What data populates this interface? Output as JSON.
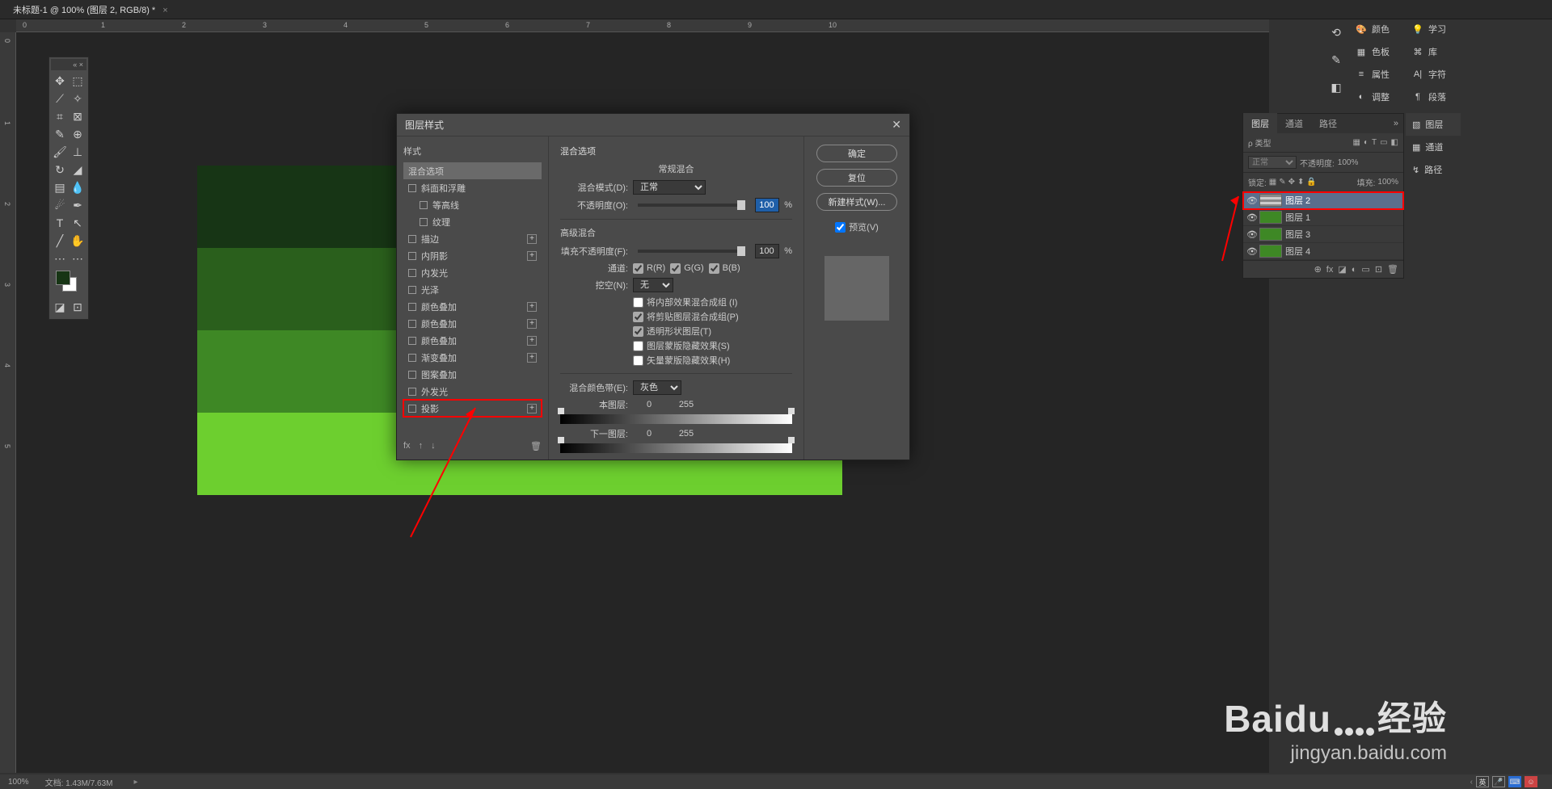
{
  "doc_tab": {
    "title": "未标题-1 @ 100% (图层 2, RGB/8) *"
  },
  "ruler_top": [
    "0",
    "1",
    "2",
    "3",
    "4",
    "5",
    "6",
    "7",
    "8",
    "9",
    "10"
  ],
  "ruler_left": [
    "0",
    "1",
    "2",
    "3",
    "4",
    "5"
  ],
  "status": {
    "zoom": "100%",
    "doc_info": "文档: 1.43M/7.63M"
  },
  "right_panels_col1": [
    {
      "icon": "🎨",
      "label": "颜色"
    },
    {
      "icon": "▦",
      "label": "色板"
    },
    {
      "icon": "≡",
      "label": "属性"
    },
    {
      "icon": "◐",
      "label": "调整"
    }
  ],
  "right_panels_col2": [
    {
      "icon": "💡",
      "label": "学习"
    },
    {
      "icon": "⌘",
      "label": "库"
    },
    {
      "icon": "A|",
      "label": "字符"
    },
    {
      "icon": "¶",
      "label": "段落"
    }
  ],
  "layers_panel": {
    "tabs": [
      "图层",
      "通道",
      "路径"
    ],
    "menu_icon": "»",
    "kind_label": "ρ 类型",
    "filter_icons": [
      "▦",
      "◐",
      "T",
      "▭",
      "◧"
    ],
    "blend_mode": "正常",
    "opacity_label": "不透明度:",
    "opacity_value": "100%",
    "lock_label": "锁定:",
    "lock_icons": [
      "▦",
      "✎",
      "✥",
      "⬍",
      "🔒"
    ],
    "fill_label": "填充:",
    "fill_value": "100%",
    "layers": [
      {
        "name": "图层 2",
        "selected": true,
        "highlight": true
      },
      {
        "name": "图层 1"
      },
      {
        "name": "图层 3"
      },
      {
        "name": "图层 4"
      }
    ],
    "footer_icons": [
      "⊕",
      "fx",
      "◪",
      "◐",
      "▭",
      "⊡",
      "🗑"
    ]
  },
  "stack_tabs": [
    {
      "icon": "▧",
      "label": "图层",
      "active": true
    },
    {
      "icon": "▦",
      "label": "通道"
    },
    {
      "icon": "↯",
      "label": "路径"
    }
  ],
  "dialog": {
    "title": "图层样式",
    "left_title": "样式",
    "styles": [
      {
        "label": "混合选项",
        "selected": true,
        "no_check": true
      },
      {
        "label": "斜面和浮雕"
      },
      {
        "label": "等高线",
        "indent": true
      },
      {
        "label": "纹理",
        "indent": true
      },
      {
        "label": "描边",
        "plus": true
      },
      {
        "label": "内阴影",
        "plus": true
      },
      {
        "label": "内发光"
      },
      {
        "label": "光泽"
      },
      {
        "label": "颜色叠加",
        "plus": true
      },
      {
        "label": "颜色叠加",
        "plus": true
      },
      {
        "label": "颜色叠加",
        "plus": true
      },
      {
        "label": "渐变叠加",
        "plus": true
      },
      {
        "label": "图案叠加"
      },
      {
        "label": "外发光"
      },
      {
        "label": "投影",
        "plus": true,
        "highlight": true
      }
    ],
    "left_footer_icons": [
      "fx",
      "↑",
      "↓"
    ],
    "trash_icon": "🗑",
    "mid": {
      "title": "混合选项",
      "general_title": "常规混合",
      "blend_mode_label": "混合模式(D):",
      "blend_mode_value": "正常",
      "opacity_label": "不透明度(O):",
      "opacity_value": "100",
      "percent": "%",
      "advanced_title": "高级混合",
      "fill_opacity_label": "填充不透明度(F):",
      "fill_opacity_value": "100",
      "channels_label": "通道:",
      "channels": [
        {
          "l": "R(R)",
          "c": true
        },
        {
          "l": "G(G)",
          "c": true
        },
        {
          "l": "B(B)",
          "c": true
        }
      ],
      "knockout_label": "挖空(N):",
      "knockout_value": "无",
      "checks": [
        {
          "l": "将内部效果混合成组 (I)",
          "c": false
        },
        {
          "l": "将剪贴图层混合成组(P)",
          "c": true
        },
        {
          "l": "透明形状图层(T)",
          "c": true
        },
        {
          "l": "图层蒙版隐藏效果(S)",
          "c": false
        },
        {
          "l": "矢量蒙版隐藏效果(H)",
          "c": false
        }
      ],
      "blend_if_label": "混合颜色带(E):",
      "blend_if_value": "灰色",
      "this_layer_label": "本图层:",
      "this_layer_min": "0",
      "this_layer_max": "255",
      "under_layer_label": "下一图层:",
      "under_layer_min": "0",
      "under_layer_max": "255"
    },
    "right": {
      "ok": "确定",
      "cancel": "复位",
      "new_style": "新建样式(W)...",
      "preview_label": "预览(V)"
    }
  },
  "watermark": {
    "brand": "Baidu",
    "jy": "经验",
    "url": "jingyan.baidu.com"
  },
  "ime": {
    "label": "英",
    "mic": "🎤",
    "key": "⌨",
    "smile": "☺"
  }
}
